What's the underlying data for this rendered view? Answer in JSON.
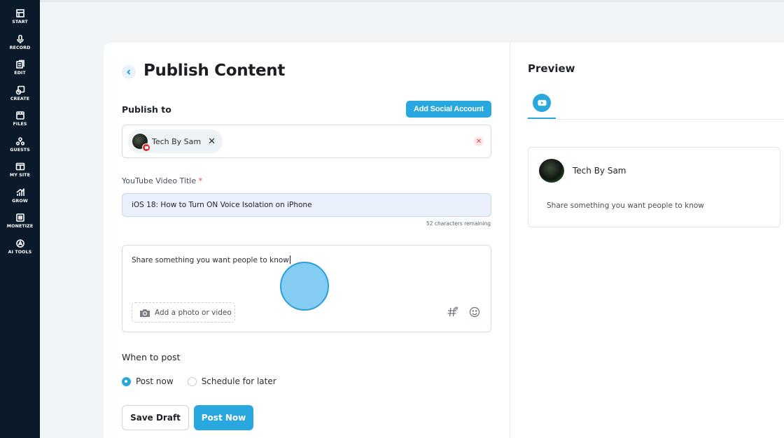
{
  "sidebar": {
    "items": [
      {
        "label": "START",
        "icon": "start-icon"
      },
      {
        "label": "RECORD",
        "icon": "microphone-icon"
      },
      {
        "label": "EDIT",
        "icon": "edit-icon"
      },
      {
        "label": "CREATE",
        "icon": "create-icon"
      },
      {
        "label": "FILES",
        "icon": "files-icon"
      },
      {
        "label": "GUESTS",
        "icon": "guests-icon"
      },
      {
        "label": "MY SITE",
        "icon": "site-icon"
      },
      {
        "label": "GROW",
        "icon": "grow-icon"
      },
      {
        "label": "MONETIZE",
        "icon": "monetize-icon"
      },
      {
        "label": "AI TOOLS",
        "icon": "ai-tools-icon"
      }
    ]
  },
  "page": {
    "title": "Publish Content"
  },
  "publish": {
    "label": "Publish to",
    "add_account_label": "Add Social Account",
    "selected_account": "Tech By Sam"
  },
  "video_title": {
    "label": "YouTube Video Title",
    "required_mark": "*",
    "value": "iOS 18: How to Turn ON Voice Isolation on iPhone",
    "chars_remaining": "52 characters remaining"
  },
  "description": {
    "value": "Share something you want people to know",
    "add_media_label": "Add a photo or video"
  },
  "schedule": {
    "label": "When to post",
    "options": [
      "Post now",
      "Schedule for later"
    ],
    "selected": "Post now"
  },
  "actions": {
    "save_draft": "Save Draft",
    "post_now": "Post Now"
  },
  "preview": {
    "title": "Preview",
    "account_name": "Tech By Sam",
    "description": "Share something you want people to know"
  },
  "colors": {
    "accent": "#29a8e0",
    "sidebar_bg": "#0b1a2a",
    "youtube_red": "#e42a2a"
  }
}
